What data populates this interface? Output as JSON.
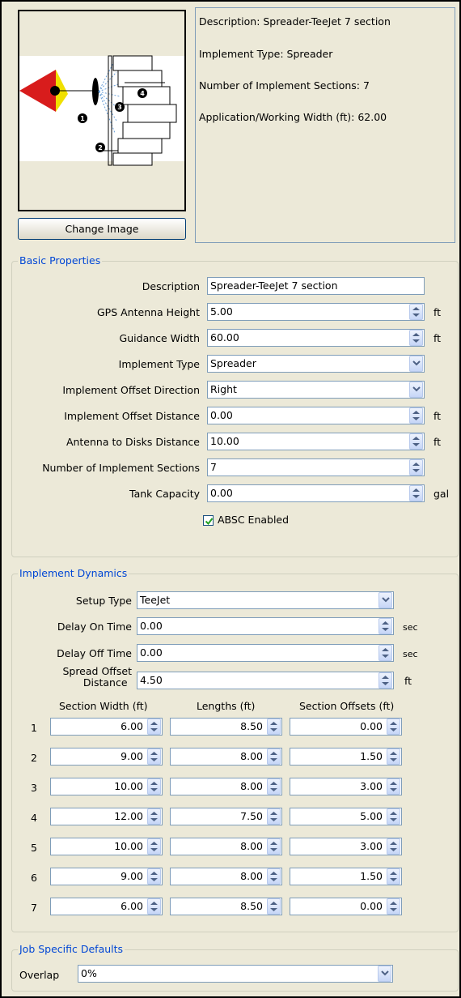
{
  "change_image_label": "Change Image",
  "info": {
    "description": "Description: Spreader-TeeJet 7 section",
    "implement_type": "Implement Type: Spreader",
    "sections": "Number of Implement Sections: 7",
    "width": "Application/Working Width (ft): 62.00"
  },
  "diagram_labels": [
    "1",
    "2",
    "3",
    "4"
  ],
  "basic": {
    "title": "Basic Properties",
    "description_label": "Description",
    "description_value": "Spreader-TeeJet 7 section",
    "gps_label": "GPS Antenna Height",
    "gps_value": "5.00",
    "gps_unit": "ft",
    "guidance_label": "Guidance Width",
    "guidance_value": "60.00",
    "guidance_unit": "ft",
    "type_label": "Implement Type",
    "type_value": "Spreader",
    "offset_dir_label": "Implement Offset Direction",
    "offset_dir_value": "Right",
    "offset_dist_label": "Implement Offset Distance",
    "offset_dist_value": "0.00",
    "offset_dist_unit": "ft",
    "antenna_label": "Antenna to Disks Distance",
    "antenna_value": "10.00",
    "antenna_unit": "ft",
    "num_sections_label": "Number of Implement Sections",
    "num_sections_value": "7",
    "tank_label": "Tank Capacity",
    "tank_value": "0.00",
    "tank_unit": "gal",
    "absc_label": "ABSC Enabled",
    "absc_checked": true
  },
  "dynamics": {
    "title": "Implement Dynamics",
    "setup_label": "Setup Type",
    "setup_value": "TeeJet",
    "delay_on_label": "Delay On Time",
    "delay_on_value": "0.00",
    "delay_on_unit": "sec",
    "delay_off_label": "Delay Off Time",
    "delay_off_value": "0.00",
    "delay_off_unit": "sec",
    "spread_label_1": "Spread Offset",
    "spread_label_2": "Distance",
    "spread_value": "4.50",
    "spread_unit": "ft",
    "col_width": "Section Width (ft)",
    "col_length": "Lengths (ft)",
    "col_offset": "Section Offsets (ft)",
    "rows": [
      {
        "n": "1",
        "width": "6.00",
        "length": "8.50",
        "offset": "0.00"
      },
      {
        "n": "2",
        "width": "9.00",
        "length": "8.00",
        "offset": "1.50"
      },
      {
        "n": "3",
        "width": "10.00",
        "length": "8.00",
        "offset": "3.00"
      },
      {
        "n": "4",
        "width": "12.00",
        "length": "7.50",
        "offset": "5.00"
      },
      {
        "n": "5",
        "width": "10.00",
        "length": "8.00",
        "offset": "3.00"
      },
      {
        "n": "6",
        "width": "9.00",
        "length": "8.00",
        "offset": "1.50"
      },
      {
        "n": "7",
        "width": "6.00",
        "length": "8.50",
        "offset": "0.00"
      }
    ]
  },
  "job": {
    "title": "Job Specific Defaults",
    "overlap_label": "Overlap",
    "overlap_value": "0%"
  },
  "colors": {
    "accent": "#0046d5",
    "field_border": "#7f9db9",
    "background": "#ece9d8",
    "check": "#21a121"
  }
}
